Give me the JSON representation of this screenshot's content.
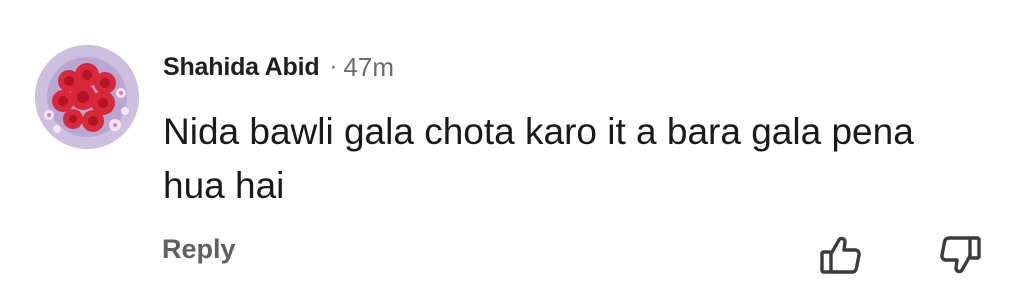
{
  "comment": {
    "author": "Shahida Abid",
    "separator": "·",
    "time": "47m",
    "text": "Nida bawli gala chota karo it a bara gala pena hua hai",
    "reply_label": "Reply",
    "avatar_icon": "rose-bouquet-avatar",
    "like_icon": "thumbs-up-icon",
    "dislike_icon": "thumbs-down-icon"
  },
  "colors": {
    "author": "#1f1f1f",
    "meta": "#6b6b6b",
    "text": "#1a1a1a",
    "reply": "#606060",
    "icon_stroke": "#3c3c3c"
  }
}
